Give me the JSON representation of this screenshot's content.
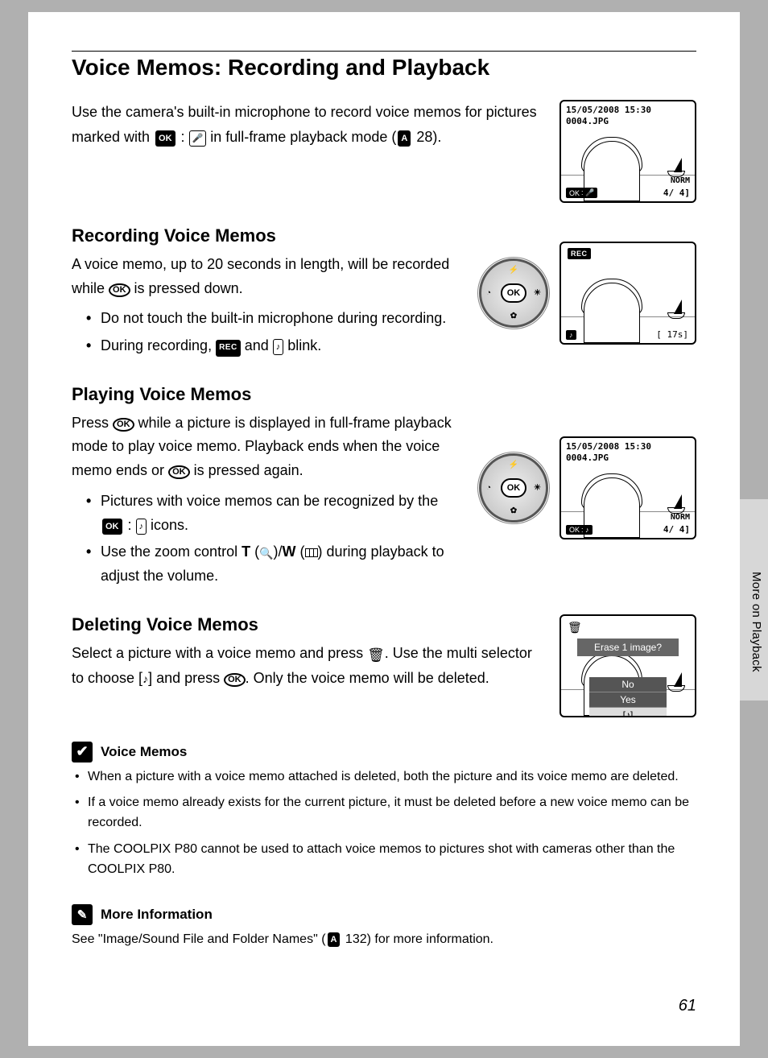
{
  "title": "Voice Memos: Recording and Playback",
  "side_label": "More on Playback",
  "page_number": "61",
  "intro": {
    "pre": "Use the camera's built-in microphone to record voice memos for pictures marked with ",
    "glyph1": "OK",
    "mid": " : ",
    "post": " in full-frame playback mode (",
    "ref_icon": "A",
    "ref_page": " 28)."
  },
  "lcd1": {
    "timestamp": "15/05/2008 15:30",
    "filename": "0004.JPG",
    "ok_label": "OK",
    "norm": "NORM",
    "counter": "4/    4]"
  },
  "recording": {
    "heading": "Recording Voice Memos",
    "p1_pre": "A voice memo, up to 20 seconds in length, will be recorded while ",
    "ok": "OK",
    "p1_post": " is pressed down.",
    "b1": "Do not touch the built-in microphone during recording.",
    "b2_pre": "During recording, ",
    "rec": "REC",
    "b2_mid": " and ",
    "b2_post": " blink."
  },
  "dial_ok": "OK",
  "lcd2": {
    "rec": "REC",
    "timer": "[   17s]"
  },
  "playing": {
    "heading": "Playing Voice Memos",
    "p1_pre": "Press ",
    "ok": "OK",
    "p1_mid": " while a picture is displayed in full-frame playback mode to play voice memo. Playback ends when the voice memo ends or ",
    "p1_post": " is pressed again.",
    "b1_pre": "Pictures with voice memos can be recognized by the ",
    "b1_glyph": "OK",
    "b1_mid": " : ",
    "b1_post": " icons.",
    "b2_pre": "Use the zoom control ",
    "T": "T",
    "W": "W",
    "b2_post": " during playback to adjust the volume."
  },
  "lcd3": {
    "timestamp": "15/05/2008 15:30",
    "filename": "0004.JPG",
    "ok_label": "OK",
    "norm": "NORM",
    "counter": "4/    4]"
  },
  "deleting": {
    "heading": "Deleting Voice Memos",
    "p_pre": "Select a picture with a voice memo and press ",
    "p_mid": ". Use the multi selector to choose [",
    "p_mid2": "] and press ",
    "ok": "OK",
    "p_post": ". Only the voice memo will be deleted."
  },
  "lcd4": {
    "dialog_title": "Erase 1 image?",
    "opt_no": "No",
    "opt_yes": "Yes",
    "opt_note": "♪"
  },
  "notes": {
    "heading": "Voice Memos",
    "n1": "When a picture with a voice memo attached is deleted, both the picture and its voice memo are deleted.",
    "n2": "If a voice memo already exists for the current picture, it must be deleted before a new voice memo can be recorded.",
    "n3": "The COOLPIX P80 cannot be used to attach voice memos to pictures shot with cameras other than the COOLPIX P80."
  },
  "more_info": {
    "heading": "More Information",
    "text_pre": "See \"Image/Sound File and Folder Names\" (",
    "ref_icon": "A",
    "ref_page": " 132) for more information."
  }
}
